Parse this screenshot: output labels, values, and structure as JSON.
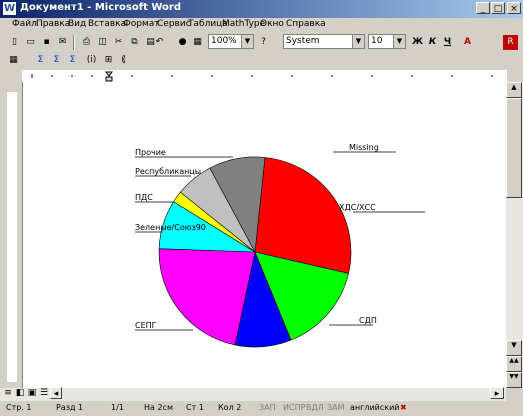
{
  "window": {
    "title": "Документ1 - Microsoft Word",
    "app_icon": "W"
  },
  "menu": [
    "Файл",
    "Правка",
    "Вид",
    "Вставка",
    "Формат",
    "Сервис",
    "Таблица",
    "MathType",
    "Окно",
    "Справка"
  ],
  "toolbar": {
    "zoom": "100%",
    "font": "System",
    "size": "10",
    "bold": "Ж",
    "italic": "К",
    "underline": "Ч",
    "font_color_label": "A"
  },
  "chart_data": {
    "type": "pie",
    "title": "",
    "slices": [
      {
        "label": "Missing",
        "color": "#ff0000"
      },
      {
        "label": "ХДС/ХСС",
        "color": "#00ff00"
      },
      {
        "label": "СДП",
        "color": "#0000ff"
      },
      {
        "label": "СЕПГ",
        "color": "#ff00ff"
      },
      {
        "label": "Зеленые/Союз90",
        "color": "#00ffff"
      },
      {
        "label": "ПДС",
        "color": "#ffff00"
      },
      {
        "label": "Республиканцы",
        "color": "#c0c0c0"
      },
      {
        "label": "Прочие",
        "color": "#808080"
      }
    ]
  },
  "status": {
    "page": "Стр. 1",
    "section": "Разд 1",
    "pages": "1/1",
    "at": "На 2см",
    "line": "Ст 1",
    "col": "Кол 2",
    "rec": "ЗАП",
    "trk": "ИСПР",
    "ext": "ВДЛ",
    "ovr": "ЗАМ",
    "lang": "английский"
  }
}
